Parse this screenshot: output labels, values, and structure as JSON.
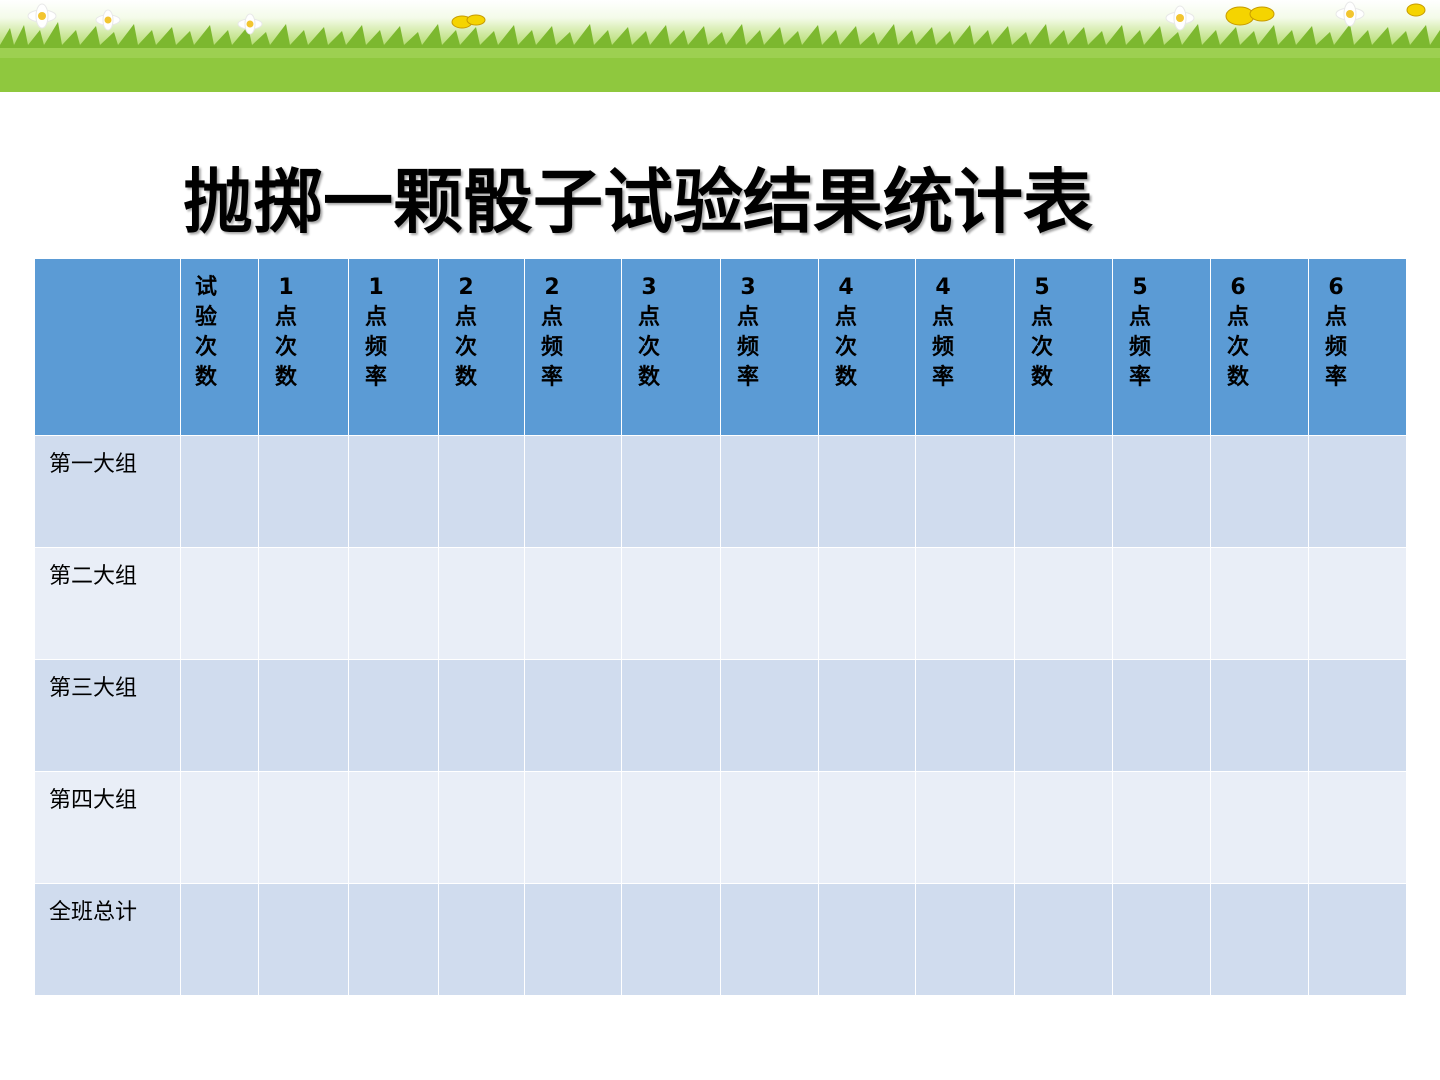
{
  "title": "抛掷一颗骰子试验结果统计表",
  "table": {
    "headers": [
      "",
      "试验次数",
      "1点次数",
      "1点频率",
      "2点次数",
      "2点频率",
      "3点次数",
      "3点频率",
      "4点次数",
      "4点频率",
      "5点次数",
      "5点频率",
      "6点次数",
      "6点频率"
    ],
    "rows": [
      {
        "label": "第一大组",
        "cells": [
          "",
          "",
          "",
          "",
          "",
          "",
          "",
          "",
          "",
          "",
          "",
          "",
          ""
        ]
      },
      {
        "label": "第二大组",
        "cells": [
          "",
          "",
          "",
          "",
          "",
          "",
          "",
          "",
          "",
          "",
          "",
          "",
          ""
        ]
      },
      {
        "label": "第三大组",
        "cells": [
          "",
          "",
          "",
          "",
          "",
          "",
          "",
          "",
          "",
          "",
          "",
          "",
          ""
        ]
      },
      {
        "label": "第四大组",
        "cells": [
          "",
          "",
          "",
          "",
          "",
          "",
          "",
          "",
          "",
          "",
          "",
          "",
          ""
        ]
      },
      {
        "label": "全班总计",
        "cells": [
          "",
          "",
          "",
          "",
          "",
          "",
          "",
          "",
          "",
          "",
          "",
          "",
          ""
        ]
      }
    ]
  },
  "colors": {
    "header_bg": "#5b9bd5",
    "row_odd_bg": "#d0dcee",
    "row_even_bg": "#e9eef7",
    "banner_grass": "#8fc83e"
  }
}
